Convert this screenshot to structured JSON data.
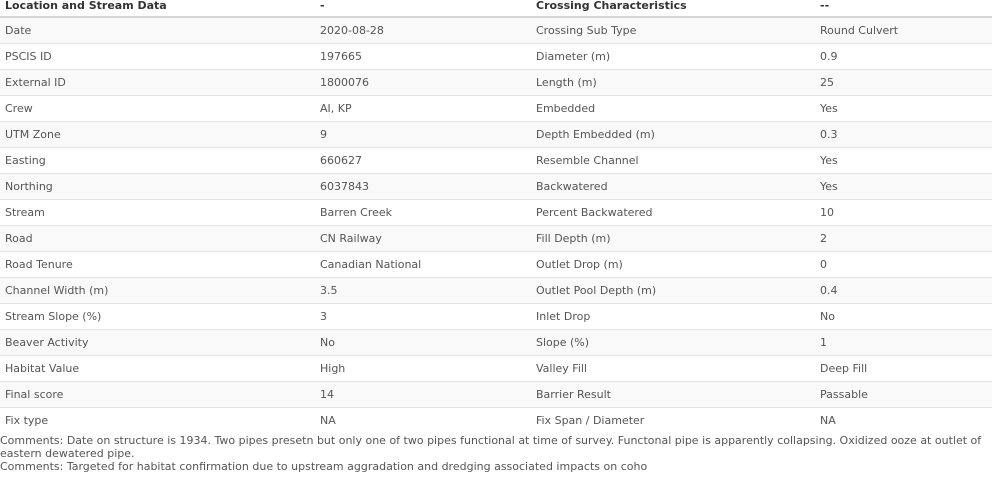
{
  "header": {
    "col1": "Location and Stream Data",
    "col2": "-",
    "col3": "Crossing Characteristics",
    "col4": "--"
  },
  "rows": [
    {
      "l1": "Date",
      "v1": "2020-08-28",
      "l2": "Crossing Sub Type",
      "v2": "Round Culvert"
    },
    {
      "l1": "PSCIS ID",
      "v1": "197665",
      "l2": "Diameter (m)",
      "v2": "0.9"
    },
    {
      "l1": "External ID",
      "v1": "1800076",
      "l2": "Length (m)",
      "v2": "25"
    },
    {
      "l1": "Crew",
      "v1": "AI, KP",
      "l2": "Embedded",
      "v2": "Yes"
    },
    {
      "l1": "UTM Zone",
      "v1": "9",
      "l2": "Depth Embedded (m)",
      "v2": "0.3"
    },
    {
      "l1": "Easting",
      "v1": "660627",
      "l2": "Resemble Channel",
      "v2": "Yes"
    },
    {
      "l1": "Northing",
      "v1": "6037843",
      "l2": "Backwatered",
      "v2": "Yes"
    },
    {
      "l1": "Stream",
      "v1": "Barren Creek",
      "l2": "Percent Backwatered",
      "v2": "10"
    },
    {
      "l1": "Road",
      "v1": "CN Railway",
      "l2": "Fill Depth (m)",
      "v2": "2"
    },
    {
      "l1": "Road Tenure",
      "v1": "Canadian National",
      "l2": "Outlet Drop (m)",
      "v2": "0"
    },
    {
      "l1": "Channel Width (m)",
      "v1": "3.5",
      "l2": "Outlet Pool Depth (m)",
      "v2": "0.4"
    },
    {
      "l1": "Stream Slope (%)",
      "v1": "3",
      "l2": "Inlet Drop",
      "v2": "No"
    },
    {
      "l1": "Beaver Activity",
      "v1": "No",
      "l2": "Slope (%)",
      "v2": "1"
    },
    {
      "l1": "Habitat Value",
      "v1": "High",
      "l2": "Valley Fill",
      "v2": "Deep Fill"
    },
    {
      "l1": "Final score",
      "v1": "14",
      "l2": "Barrier Result",
      "v2": "Passable"
    },
    {
      "l1": "Fix type",
      "v1": "NA",
      "l2": "Fix Span / Diameter",
      "v2": "NA"
    }
  ],
  "comments": [
    "Comments: Date on structure is 1934. Two pipes presetn but only one of two pipes functional at time of survey. Functonal pipe is apparently collapsing. Oxidized ooze at outlet of eastern dewatered pipe.",
    "Comments: Targeted for habitat confirmation due to upstream aggradation and dredging associated impacts on coho"
  ]
}
